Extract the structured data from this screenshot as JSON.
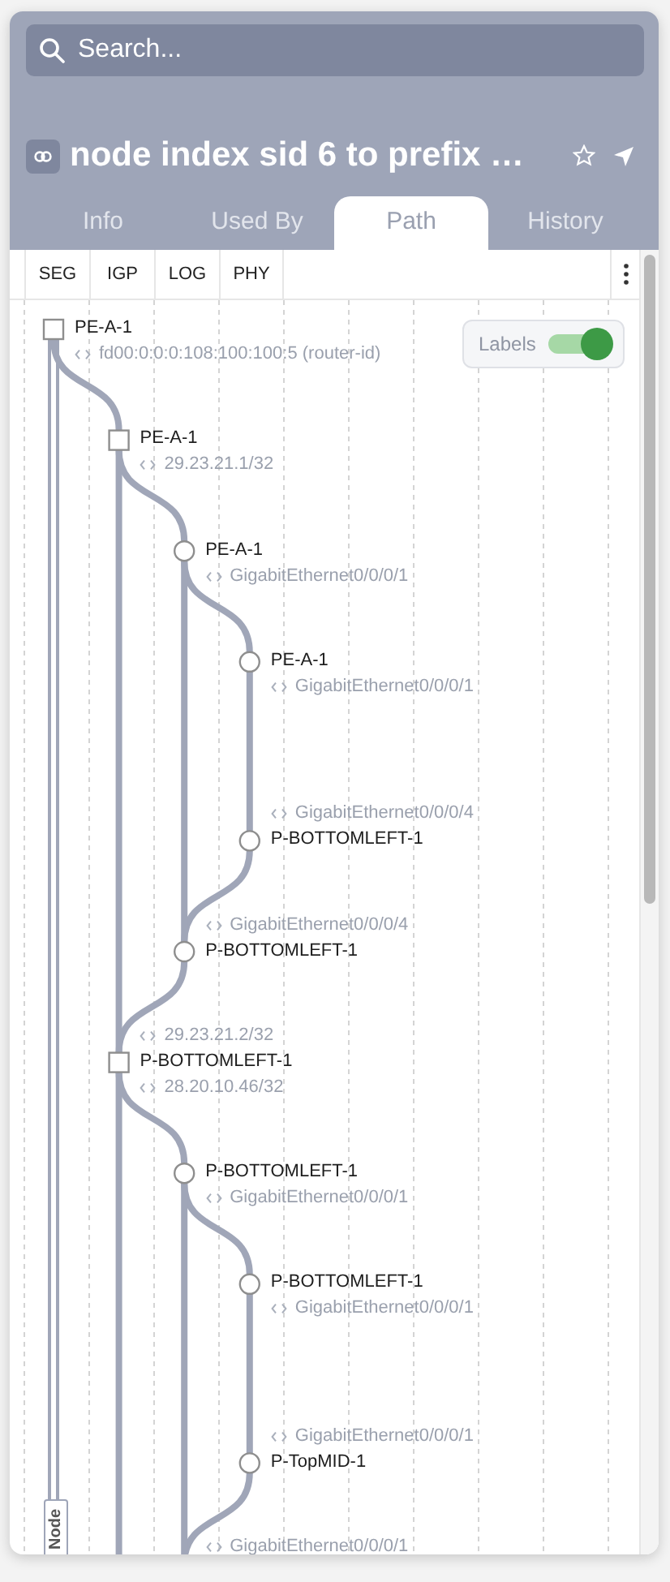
{
  "search": {
    "placeholder": "Search..."
  },
  "title": {
    "text": "node index sid 6 to prefix …"
  },
  "tabs": [
    {
      "label": "Info",
      "selected": false
    },
    {
      "label": "Used By",
      "selected": false
    },
    {
      "label": "Path",
      "selected": true
    },
    {
      "label": "History",
      "selected": false
    }
  ],
  "toolbar": {
    "layers": [
      "SEG",
      "IGP",
      "LOG",
      "PHY"
    ]
  },
  "labels_toggle": {
    "label": "Labels",
    "on": true
  },
  "path": {
    "lane_tag": "Node",
    "hops": [
      {
        "kind": "seg",
        "name": "PE-A-1",
        "below": "fd00:0:0:0:108:100:100:5 (router-id)"
      },
      {
        "kind": "igp",
        "name": "PE-A-1",
        "below": "29.23.21.1/32"
      },
      {
        "kind": "log",
        "name": "PE-A-1",
        "below": "GigabitEthernet0/0/0/1"
      },
      {
        "kind": "phy",
        "name": "PE-A-1",
        "below": "GigabitEthernet0/0/0/1"
      },
      {
        "kind": "phy",
        "name": "P-BOTTOMLEFT-1",
        "above": "GigabitEthernet0/0/0/4"
      },
      {
        "kind": "log",
        "name": "P-BOTTOMLEFT-1",
        "above": "GigabitEthernet0/0/0/4"
      },
      {
        "kind": "igp",
        "name": "P-BOTTOMLEFT-1",
        "above": "29.23.21.2/32",
        "below": "28.20.10.46/32"
      },
      {
        "kind": "log",
        "name": "P-BOTTOMLEFT-1",
        "below": "GigabitEthernet0/0/0/1"
      },
      {
        "kind": "phy",
        "name": "P-BOTTOMLEFT-1",
        "below": "GigabitEthernet0/0/0/1"
      },
      {
        "kind": "phy",
        "name": "P-TopMID-1",
        "above": "GigabitEthernet0/0/0/1"
      },
      {
        "kind": "log",
        "above": "GigabitEthernet0/0/0/1"
      }
    ]
  }
}
